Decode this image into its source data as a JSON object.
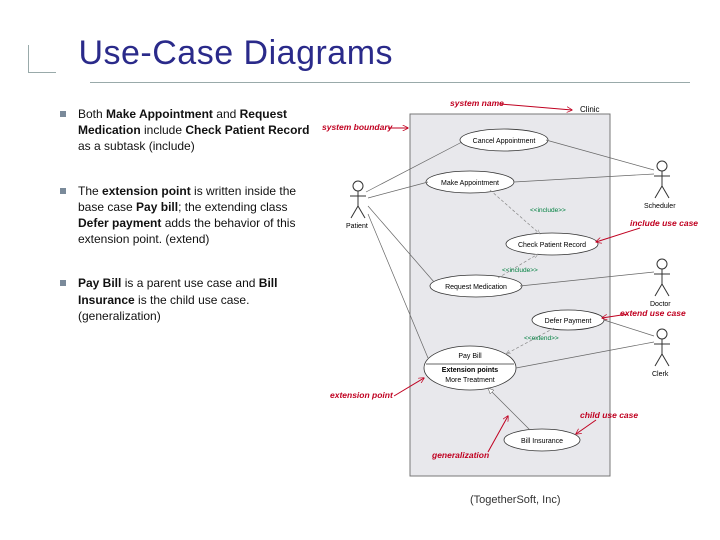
{
  "title": "Use-Case Diagrams",
  "bullets": [
    {
      "pre": "Both ",
      "b1": "Make Appointment",
      "mid1": " and ",
      "b2": "Request Medication",
      "mid2": " include ",
      "b3": "Check Patient Record",
      "post": " as a subtask (include)"
    },
    {
      "pre": "The ",
      "b1": "extension point",
      "mid1": " is written inside the base case ",
      "b2": "Pay bill",
      "mid2": "; the extending class ",
      "b3": "Defer payment",
      "post": " adds the behavior of this extension point. (extend)"
    },
    {
      "pre": "",
      "b1": "Pay Bill",
      "mid1": " is a parent use case and ",
      "b2": "Bill Insurance",
      "mid2": " is the child use case. (generalization)",
      "b3": "",
      "post": ""
    }
  ],
  "credit": "(TogetherSoft, Inc)",
  "diagram": {
    "system_name": "Clinic",
    "actors": {
      "patient": "Patient",
      "scheduler": "Scheduler",
      "doctor": "Doctor",
      "clerk": "Clerk"
    },
    "usecases": {
      "cancel": "Cancel Appointment",
      "make": "Make Appointment",
      "check": "Check Patient Record",
      "request": "Request Medication",
      "defer": "Defer Payment",
      "paybill": "Pay Bill",
      "ext_label": "Extension points",
      "ext_value": "More Treatment",
      "billins": "Bill Insurance"
    },
    "stereo": {
      "include": "<<include>>",
      "extend": "<<extend>>"
    },
    "annotations": {
      "system_name": "system name",
      "system_boundary": "system boundary",
      "include_use_case": "include use case",
      "extend_use_case": "extend use case",
      "extension_point": "extension point",
      "child_use_case": "child use case",
      "generalization": "generalization"
    }
  }
}
